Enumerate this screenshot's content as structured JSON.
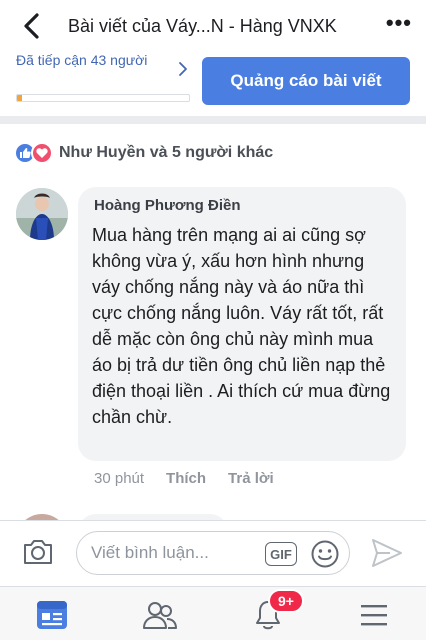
{
  "header": {
    "title": "Bài viết của Váy...N - Hàng VNXK",
    "back_icon": "chevron-left-icon",
    "more_icon": "more-dots-icon",
    "more_label": "•••"
  },
  "reach": {
    "text": "Đã tiếp cận 43 người",
    "progress_fraction": 0.03,
    "promote_label": "Quảng cáo bài viết"
  },
  "reactions": {
    "icons": [
      "like-icon",
      "love-icon"
    ],
    "text": "Như Huyền và 5 người khác"
  },
  "comment": {
    "author": "Hoàng Phương Điền",
    "text": "Mua hàng trên mạng ai ai cũng sợ không vừa ý, xấu hơn hình nhưng váy chống nắng này và áo nữa thì cực chống nắng luôn. Váy rất tốt, rất dễ mặc còn ông chủ này mình mua áo bị trả dư tiền ông chủ liền nạp thẻ điện thoại liền . Ai thích cứ mua đừng chần chừ.",
    "time": "30 phút",
    "like_label": "Thích",
    "reply_label": "Trả lời"
  },
  "composer": {
    "placeholder": "Viết bình luận...",
    "gif_label": "GIF"
  },
  "nav": {
    "items": [
      "news-feed-icon",
      "friends-icon",
      "notifications-icon",
      "menu-icon"
    ],
    "notification_badge": "9+"
  },
  "colors": {
    "accent": "#4a7ee0",
    "link": "#4267b2",
    "badge": "#f02849",
    "progress": "#f0a63a"
  }
}
